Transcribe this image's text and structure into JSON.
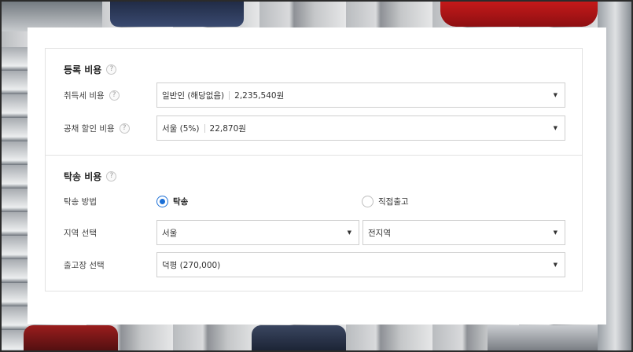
{
  "registration": {
    "title": "등록 비용",
    "help_icon": "?",
    "acquisition_tax": {
      "label": "취득세 비용",
      "selected_option": "일반인 (해당없음)",
      "amount": "2,235,540원"
    },
    "bond_discount": {
      "label": "공채 할인 비용",
      "selected_option": "서울 (5%)",
      "amount": "22,870원"
    }
  },
  "shipping": {
    "title": "탁송 비용",
    "help_icon": "?",
    "method": {
      "label": "탁송 방법",
      "options": [
        {
          "label": "탁송",
          "checked": true
        },
        {
          "label": "직접출고",
          "checked": false
        }
      ]
    },
    "region": {
      "label": "지역 선택",
      "city": "서울",
      "district": "전지역"
    },
    "depot": {
      "label": "출고장 선택",
      "selected_option": "덕평 (270,000)"
    }
  },
  "icons": {
    "dropdown": "▼",
    "accent_color": "#1b6fd6"
  }
}
